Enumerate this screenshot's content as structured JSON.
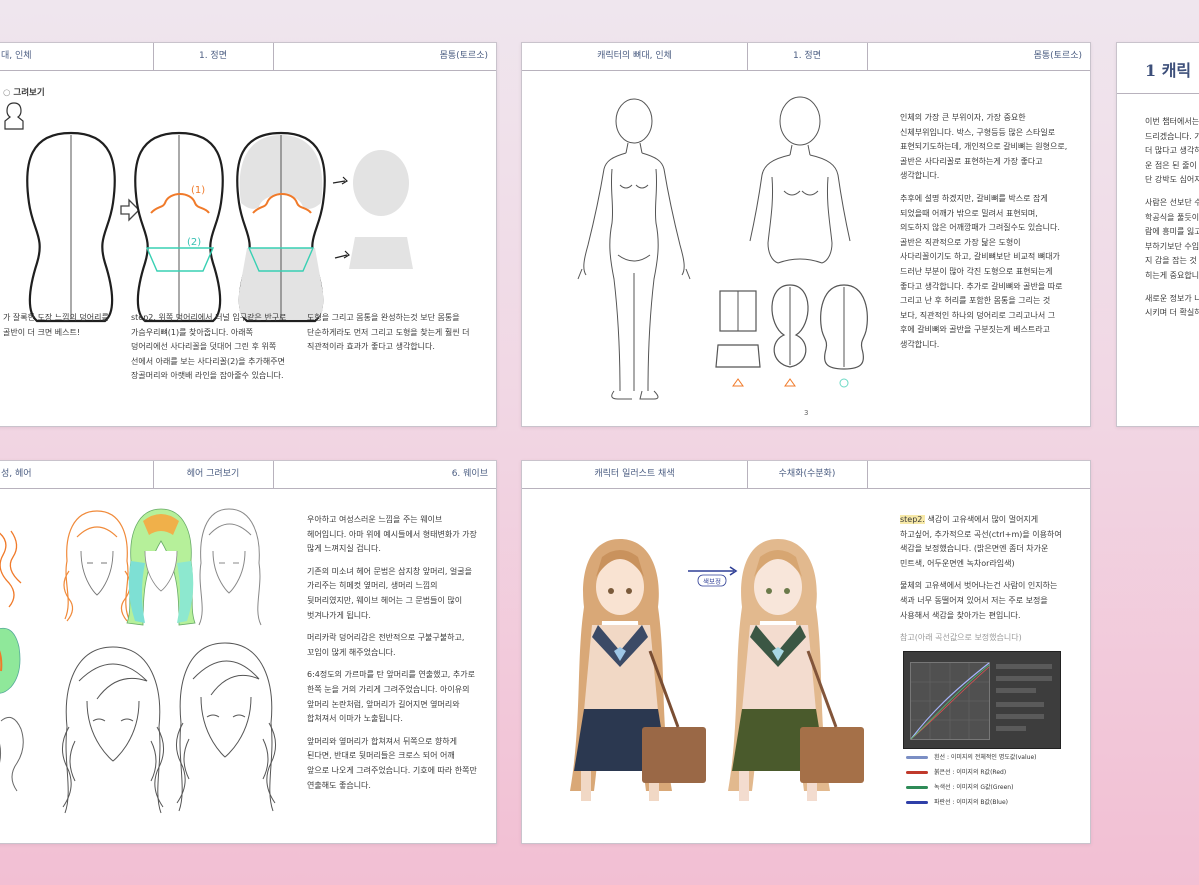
{
  "page1": {
    "header": [
      "대, 인체",
      "1. 정면",
      "몸통(토르소)"
    ],
    "section_title": "그려보기",
    "shape_labels": [
      "(1)",
      "(2)"
    ],
    "caption_left": [
      "가 잘록한 도장 느낌의 덩어리를",
      "골반이 더 크면 베스트!"
    ],
    "caption_mid": "step2. 위쪽 덩어리에서 터널 입구같은 반구로 가슴우리뼈(1)를 찾아줍니다. 아래쪽 덩어리에선 사다리꼴을 덧대어 그린 후 위쪽 선에서 아래를 보는 사다리꼴(2)을 추가해주면 장골머리와 아랫배 라인을 잡아줄수 있습니다.",
    "caption_right": "도형을 그리고 몸통을 완성하는것 보단 몸통을 단순하게라도 먼저 그리고 도형을 찾는게 훨씬 더 직관적이라 효과가 좋다고 생각합니다."
  },
  "page2": {
    "header": [
      "캐릭터의 뼈대, 인체",
      "1. 정면",
      "몸통(토르소)"
    ],
    "paragraphs": [
      "인체의 가장 큰 부위이자, 가장 중요한 신체부위입니다. 박스, 구형등등 많은 스타일로 표현되기도하는데, 개인적으로 갈비뼈는 원형으로, 골반은 사다리꼴로 표현하는게 가장 좋다고 생각합니다.",
      "추후에 설명 하겠지만, 갈비뼈를 박스로 잡게 되었을때 어깨가 밖으로 밀려서 표현되며, 의도하지 않은 어깨깡패가 그려질수도 있습니다. 골반은 직관적으로 가장 닮은 도형이 사다리꼴이기도 하고, 갈비뼈보단 비교적 뼈대가 드러난 부분이 많아 각진 도형으로 표현되는게 좋다고 생각합니다. 추가로 갈비뼈와 골반을 따로 그리고 난 후 허리를 포함한 몸통을 그리는 것 보다, 직관적인 하나의 덩어리로 그리고나서 그 후에 갈비뼈와 골반을 구분짓는게 베스트라고 생각합니다."
    ],
    "page_number": "3"
  },
  "page3": {
    "header_title": "1 캐릭",
    "lines": [
      "이번 챕터에서는",
      "드리겠습니다. 기",
      "더 많다고 생각하",
      "운 점은 된 줄이",
      "단 강박도 심어지",
      "사람은 선보단 수",
      "학공식을 풀듯이",
      "람에 흥미를 잃고",
      "부하기보단 수입",
      "지 감을 잡는 것",
      "히는게 중요합니",
      "새로운 정보가 나",
      "시키며 더 확실하"
    ]
  },
  "page4": {
    "header": [
      "성, 헤어",
      "헤어 그려보기",
      "6. 웨이브"
    ],
    "paragraphs": [
      "우아하고 여성스러운 느낌을 주는 웨이브 헤어입니다. 아마 위에 예시들에서 형태변화가 가장 많게 느껴지실 겁니다.",
      "기존의 미소녀 헤어 문법은 삼지창 앞머리, 얼굴을 가리주는 히메컷 옆머리, 생머리 느낌의 뒷머리였지만, 웨이브 헤어는 그 문법들이 많이 벗겨나가게 됩니다.",
      "머리카락 덩어리감은 전반적으로 구불구불하고, 꼬임이 많게 해주었습니다.",
      "6:4정도의 가르마를 탄 앞머리를 연출했고, 추가로 한쪽 눈을 거의 가리게 그려주었습니다. 아이유의 앞머리 논란처럼, 앞머리가 길어지면 옆머리와 합쳐져서 이마가 노출됩니다.",
      "앞머리와 옆머리가 합쳐져서 뒤쪽으로 향하게 된다면, 반대로 뒷머리들은 크로스 되어 어깨 앞으로 나오게 그려주었습니다. 기호에 따라 한쪽만 연출해도 좋습니다."
    ]
  },
  "page5": {
    "header": [
      "캐릭터 일러스트 채색",
      "수채화(수분화)"
    ],
    "step_label": "step2.",
    "step_text": "색감이 고유색에서 많이 멀어지게 하고싶어, 추가적으로 곡선(ctrl+m)을 이용하여 색감을 보정했습니다. (밝은면엔 좀더 차가운 민트색, 어두운면엔 녹차or라임색)",
    "paragraph2": "물체의 고유색에서 벗어나는건 사람이 인지하는 색과 너무 동떨어져 있어서 저는 주로 보정을 사용해서 색감을 찾아가는 편입니다.",
    "note": "참고(아래 곡선값으로 보정했습니다)",
    "arrow_label": "색보정",
    "legend": [
      {
        "label": "흰선 : 이미지의 전체적인 명도값(value)",
        "color": "#7a8ec4"
      },
      {
        "label": "붉은선 : 이미지의 R값(Red)",
        "color": "#c0392b"
      },
      {
        "label": "녹색선 : 이미지의 G값(Green)",
        "color": "#2e8b57"
      },
      {
        "label": "파란선 : 이미지의 B값(Blue)",
        "color": "#2f3fa8"
      }
    ]
  }
}
